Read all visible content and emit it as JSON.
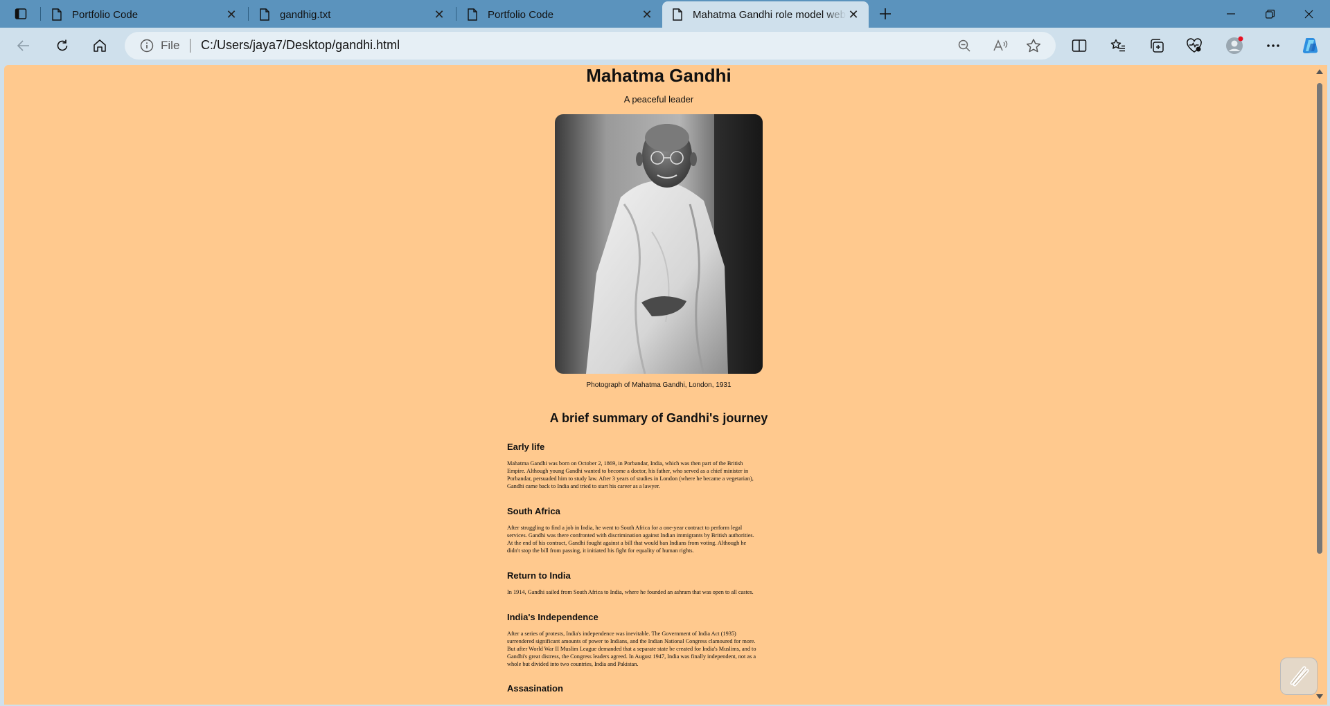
{
  "browser": {
    "tabs": [
      {
        "title": "Portfolio Code",
        "active": false
      },
      {
        "title": "gandhig.txt",
        "active": false
      },
      {
        "title": "Portfolio Code",
        "active": false
      },
      {
        "title": "Mahatma Gandhi role model website",
        "active": true
      }
    ],
    "address": {
      "scheme_label": "File",
      "url": "C:/Users/jaya7/Desktop/gandhi.html"
    },
    "colors": {
      "tabstrip": "#5b93bd",
      "toolbar": "#cfe0ec",
      "page_background": "#ffc98e"
    }
  },
  "page": {
    "title": "Mahatma Gandhi",
    "subtitle": "A peaceful leader",
    "image_caption": "Photograph of Mahatma Gandhi, London, 1931",
    "summary_heading": "A brief summary of Gandhi's journey",
    "sections": [
      {
        "heading": "Early life",
        "lines": [
          "Mahatma Gandhi was born on October 2, 1869, in Porbandar, India, which was then part of the British",
          "Empire. Although young Gandhi wanted to become a doctor, his father, who served as a chief minister in",
          "Porbandar, persuaded him to study law. After 3 years of studies in London (where he became a vegetarian),",
          "Gandhi came back to India and tried to start his career as a lawyer."
        ]
      },
      {
        "heading": "South Africa",
        "lines": [
          "After struggling to find a job in India, he went to South Africa for a one-year contract to perform legal",
          "services. Gandhi was there confronted with discrimination against Indian immigrants by British authorities.",
          "At the end of his contract, Gandhi fought against a bill that would ban Indians from voting. Although he",
          "didn't stop the bill from passing, it initiated his fight for equality of human rights."
        ]
      },
      {
        "heading": "Return to India",
        "lines": [
          "In 1914, Gandhi sailed from South Africa to India, where he founded an ashram that was open to all castes."
        ]
      },
      {
        "heading": "India's Independence",
        "lines": [
          "After a series of protests, India's independence was inevitable. The Government of India Act (1935)",
          "surrendered significant amounts of power to Indians, and the Indian National Congress clamoured for more.",
          "But after World War II Muslim League demanded that a separate state be created for India's Muslims, and to",
          "Gandhi's great distress, the Congress leaders agreed. In August 1947, India was finally independent, not as a",
          "whole but divided into two countries, India and Pakistan."
        ]
      },
      {
        "heading": "Assasination",
        "lines": []
      }
    ]
  }
}
